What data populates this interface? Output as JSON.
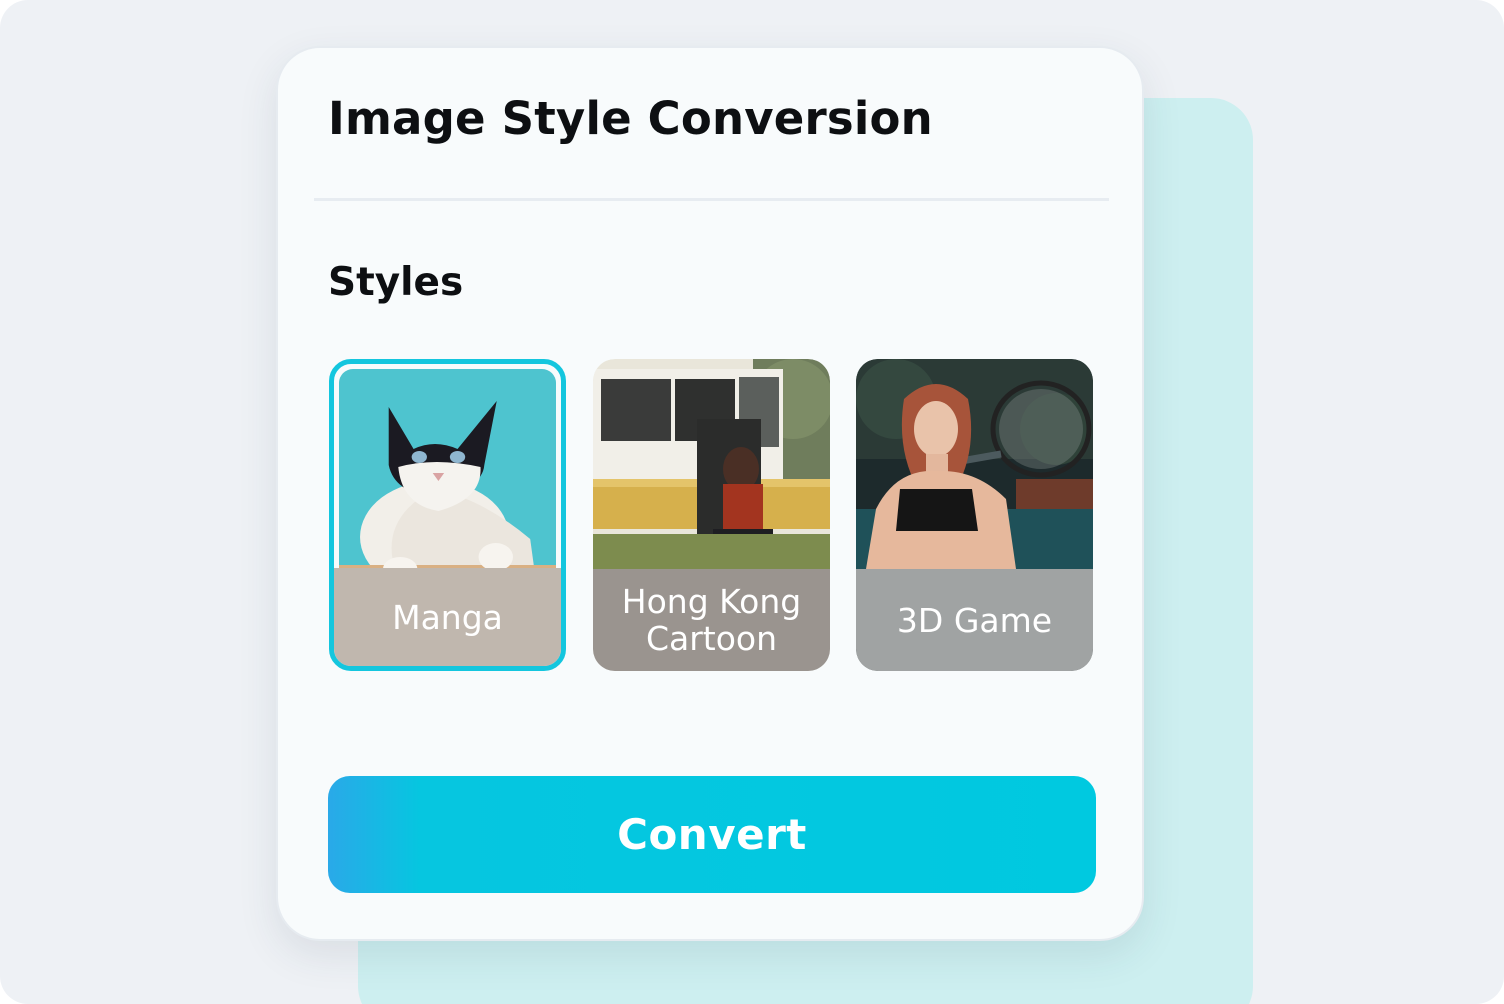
{
  "card": {
    "title": "Image Style Conversion",
    "section_label": "Styles"
  },
  "styles": [
    {
      "label": "Manga",
      "selected": true,
      "thumbnail_icon": "cat-photo"
    },
    {
      "label": "Hong Kong Cartoon",
      "selected": false,
      "thumbnail_icon": "van-photo"
    },
    {
      "label": "3D Game",
      "selected": false,
      "thumbnail_icon": "tennis-player-photo"
    }
  ],
  "actions": {
    "convert_label": "Convert"
  },
  "colors": {
    "accent": "#00c9e0",
    "accent_gradient_start": "#2aa9e8",
    "backdrop": "#cdeff0",
    "page_background": "#eef1f5",
    "card_background": "#f8fbfc",
    "text_primary": "#0d0f12"
  }
}
